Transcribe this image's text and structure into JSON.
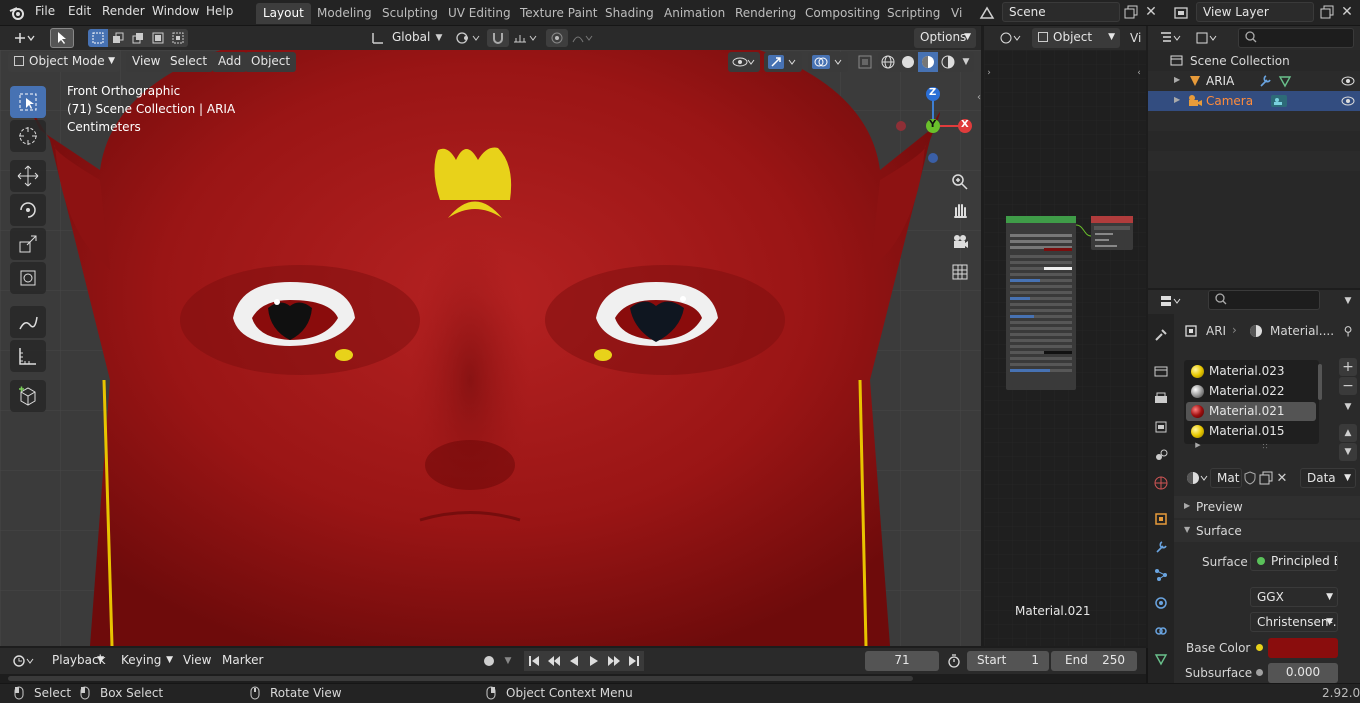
{
  "topbar": {
    "menus": [
      "File",
      "Edit",
      "Render",
      "Window",
      "Help"
    ],
    "workspaces": [
      "Layout",
      "Modeling",
      "Sculpting",
      "UV Editing",
      "Texture Paint",
      "Shading",
      "Animation",
      "Rendering",
      "Compositing",
      "Scripting",
      "Vi"
    ],
    "active_workspace": "Layout",
    "scene": "Scene",
    "view_layer": "View Layer"
  },
  "viewport_header": {
    "transform_orientation": "Global",
    "options": "Options",
    "mode": "Object Mode",
    "menus": [
      "View",
      "Select",
      "Add",
      "Object"
    ]
  },
  "viewport": {
    "view_name": "Front Orthographic",
    "collection_info": "(71) Scene Collection | ARIA",
    "units": "Centimeters",
    "gizmo": {
      "z": "Z",
      "y": "Y",
      "x": "X"
    }
  },
  "node_editor": {
    "header_object": "Object",
    "header_trunc": "Vi",
    "material_label": "Material.021",
    "bsdf_title": "Principled BSDF",
    "output_title": "Material Output"
  },
  "outliner": {
    "root": "Scene Collection",
    "items": [
      {
        "name": "ARIA",
        "selected": false
      },
      {
        "name": "Camera",
        "selected": true
      }
    ]
  },
  "properties": {
    "breadcrumb_object": "ARI",
    "breadcrumb_material": "Material....",
    "materials": [
      {
        "name": "Material.023",
        "color": "#e8c800",
        "selected": false
      },
      {
        "name": "Material.022",
        "color": "#9a9a9a",
        "selected": false
      },
      {
        "name": "Material.021",
        "color": "#a01010",
        "selected": true
      },
      {
        "name": "Material.015",
        "color": "#e8c800",
        "selected": false
      }
    ],
    "mat_name": "Mat",
    "data_link": "Data",
    "panel_preview": "Preview",
    "panel_surface": "Surface",
    "surface_label": "Surface",
    "surface_value": "Principled B...",
    "distribution": "GGX",
    "subsurface_method": "Christensen-...",
    "base_color_label": "Base Color",
    "base_color": "#8a0d0d",
    "subsurface_label": "Subsurface",
    "subsurface_value": "0.000"
  },
  "timeline": {
    "menus": [
      "Playback",
      "Keying",
      "View",
      "Marker"
    ],
    "current_frame": "71",
    "start_label": "Start",
    "start_value": "1",
    "end_label": "End",
    "end_value": "250"
  },
  "status": {
    "select": "Select",
    "box_select": "Box Select",
    "rotate_view": "Rotate View",
    "context_menu": "Object Context Menu",
    "version": "2.92.0"
  },
  "colors": {
    "accent": "#4772b3",
    "selected_text": "#ff8c3b",
    "skin": "#9c1414",
    "eye_yellow": "#e8d21a"
  }
}
